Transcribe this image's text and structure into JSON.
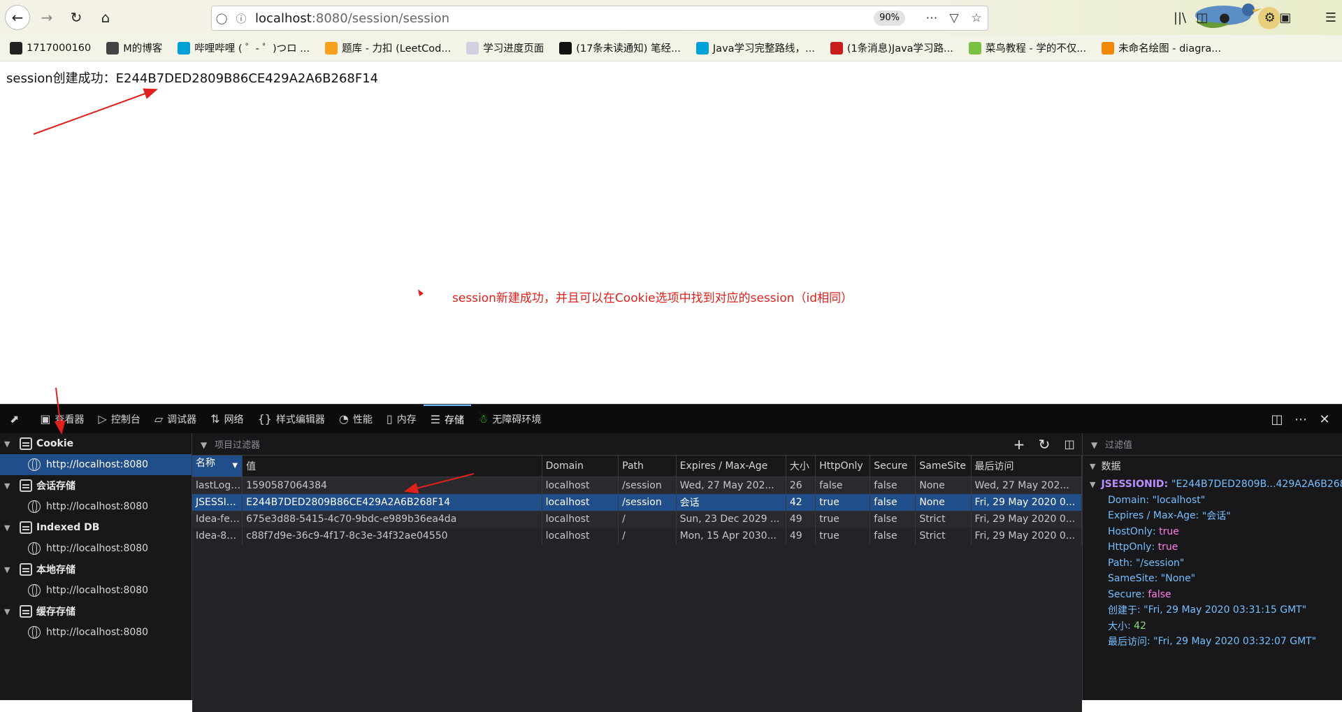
{
  "browser": {
    "url_host": "localhost",
    "url_rest": ":8080/session/session",
    "zoom": "90%"
  },
  "bookmarks": [
    {
      "label": "1717000160",
      "icon": "github-icon",
      "color": "#222"
    },
    {
      "label": "M的博客",
      "icon": "globe-icon",
      "color": "#444"
    },
    {
      "label": "哔哩哔哩 ( ゜- ゜)つロ ...",
      "icon": "bilibili-icon",
      "color": "#00a1d6"
    },
    {
      "label": "题库 - 力扣 (LeetCod...",
      "icon": "leetcode-icon",
      "color": "#f89f1b"
    },
    {
      "label": "学习进度页面",
      "icon": "page-icon",
      "color": "#d0d0e0"
    },
    {
      "label": "(17条未读通知) 笔经...",
      "icon": "niuke-icon",
      "color": "#111"
    },
    {
      "label": "Java学习完整路线，...",
      "icon": "bilibili-icon",
      "color": "#00a1d6"
    },
    {
      "label": "(1条消息)Java学习路...",
      "icon": "csdn-icon",
      "color": "#c81d1d"
    },
    {
      "label": "菜鸟教程 - 学的不仅...",
      "icon": "runoob-icon",
      "color": "#7ac143"
    },
    {
      "label": "未命名绘图 - diagra...",
      "icon": "drawio-icon",
      "color": "#f08705"
    }
  ],
  "page": {
    "session_text": "session创建成功：E244B7DED2809B86CE429A2A6B268F14",
    "annotation": "session新建成功，并且可以在Cookie选项中找到对应的session（id相同）"
  },
  "devtools": {
    "tabs": [
      {
        "label": "查看器",
        "icon": "inspector-icon"
      },
      {
        "label": "控制台",
        "icon": "console-icon"
      },
      {
        "label": "调试器",
        "icon": "debugger-icon"
      },
      {
        "label": "网络",
        "icon": "network-icon"
      },
      {
        "label": "样式编辑器",
        "icon": "braces-icon"
      },
      {
        "label": "性能",
        "icon": "performance-icon"
      },
      {
        "label": "内存",
        "icon": "memory-icon"
      },
      {
        "label": "存储",
        "icon": "storage-icon"
      },
      {
        "label": "无障碍环境",
        "icon": "accessibility-icon"
      }
    ],
    "active_tab": "存储",
    "sidebar": [
      {
        "group": "Cookie",
        "item": "http://localhost:8080",
        "selected": true
      },
      {
        "group": "会话存储",
        "item": "http://localhost:8080",
        "selected": false
      },
      {
        "group": "Indexed DB",
        "item": "http://localhost:8080",
        "selected": false
      },
      {
        "group": "本地存储",
        "item": "http://localhost:8080",
        "selected": false
      },
      {
        "group": "缓存存储",
        "item": "http://localhost:8080",
        "selected": false
      }
    ],
    "filter_placeholder": "项目过滤器",
    "table": {
      "headers": [
        "名称",
        "值",
        "Domain",
        "Path",
        "Expires / Max-Age",
        "大小",
        "HttpOnly",
        "Secure",
        "SameSite",
        "最后访问"
      ],
      "rows": [
        [
          "lastLogi...",
          "1590587064384",
          "localhost",
          "/session",
          "Wed, 27 May 202...",
          "26",
          "false",
          "false",
          "None",
          "Wed, 27 May 202..."
        ],
        [
          "JSESSIO...",
          "E244B7DED2809B86CE429A2A6B268F14",
          "localhost",
          "/session",
          "会话",
          "42",
          "true",
          "false",
          "None",
          "Fri, 29 May 2020 0..."
        ],
        [
          "Idea-fe3...",
          "675e3d88-5415-4c70-9bdc-e989b36ea4da",
          "localhost",
          "/",
          "Sun, 23 Dec 2029 ...",
          "49",
          "true",
          "false",
          "Strict",
          "Fri, 29 May 2020 0..."
        ],
        [
          "Idea-829...",
          "c88f7d9e-36c9-4f17-8c3e-34f32ae04550",
          "localhost",
          "/",
          "Mon, 15 Apr 2030...",
          "49",
          "true",
          "false",
          "Strict",
          "Fri, 29 May 2020 0..."
        ]
      ],
      "selected_row": 1
    },
    "details": {
      "filter_placeholder": "过滤值",
      "section": "数据",
      "root_key": "JSESSIONID",
      "root_value": "\"E244B7DED2809B...429A2A6B268F14\"",
      "fields": [
        {
          "k": "Domain",
          "v": "\"localhost\"",
          "t": "str"
        },
        {
          "k": "Expires / Max-Age",
          "v": "\"会话\"",
          "t": "str"
        },
        {
          "k": "HostOnly",
          "v": "true",
          "t": "bool"
        },
        {
          "k": "HttpOnly",
          "v": "true",
          "t": "bool"
        },
        {
          "k": "Path",
          "v": "\"/session\"",
          "t": "str"
        },
        {
          "k": "SameSite",
          "v": "\"None\"",
          "t": "str"
        },
        {
          "k": "Secure",
          "v": "false",
          "t": "bool"
        },
        {
          "k": "创建于",
          "v": "\"Fri, 29 May 2020 03:31:15 GMT\"",
          "t": "str"
        },
        {
          "k": "大小",
          "v": "42",
          "t": "num"
        },
        {
          "k": "最后访问",
          "v": "\"Fri, 29 May 2020 03:32:07 GMT\"",
          "t": "str"
        }
      ]
    }
  }
}
